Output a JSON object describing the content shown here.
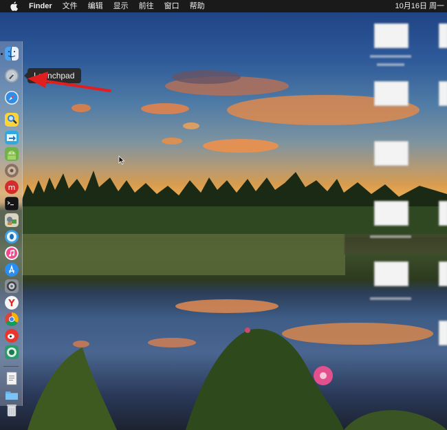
{
  "menubar": {
    "app_name": "Finder",
    "menus": [
      "文件",
      "编辑",
      "显示",
      "前往",
      "窗口",
      "帮助"
    ],
    "clock": "10月16日 周一"
  },
  "tooltip": {
    "text": "Launchpad"
  },
  "dock": {
    "items": [
      {
        "name": "finder-icon",
        "running": true
      },
      {
        "name": "launchpad-icon",
        "running": false
      },
      {
        "name": "safari-icon",
        "running": false
      },
      {
        "name": "preview-icon",
        "running": false
      },
      {
        "name": "migration-icon",
        "running": false
      },
      {
        "name": "android-icon",
        "running": false
      },
      {
        "name": "photo-icon",
        "running": false
      },
      {
        "name": "netease-icon",
        "running": false
      },
      {
        "name": "terminal-icon",
        "running": false
      },
      {
        "name": "automator-icon",
        "running": false
      },
      {
        "name": "qq-icon",
        "running": false
      },
      {
        "name": "itunes-icon",
        "running": false
      },
      {
        "name": "appstore-icon",
        "running": false
      },
      {
        "name": "system-preferences-icon",
        "running": false
      },
      {
        "name": "yandex-icon",
        "running": false
      },
      {
        "name": "chrome-icon",
        "running": false
      },
      {
        "name": "weibo-icon",
        "running": false
      },
      {
        "name": "facetime-icon",
        "running": false
      },
      {
        "name": "document-icon",
        "running": false
      },
      {
        "name": "downloads-folder-icon",
        "running": false
      },
      {
        "name": "trash-icon",
        "running": false
      }
    ]
  },
  "annotation": {
    "color": "#e21f1f"
  },
  "colors": {
    "menubar": "#1a1a1a",
    "tooltip": "#2b2b2b"
  }
}
